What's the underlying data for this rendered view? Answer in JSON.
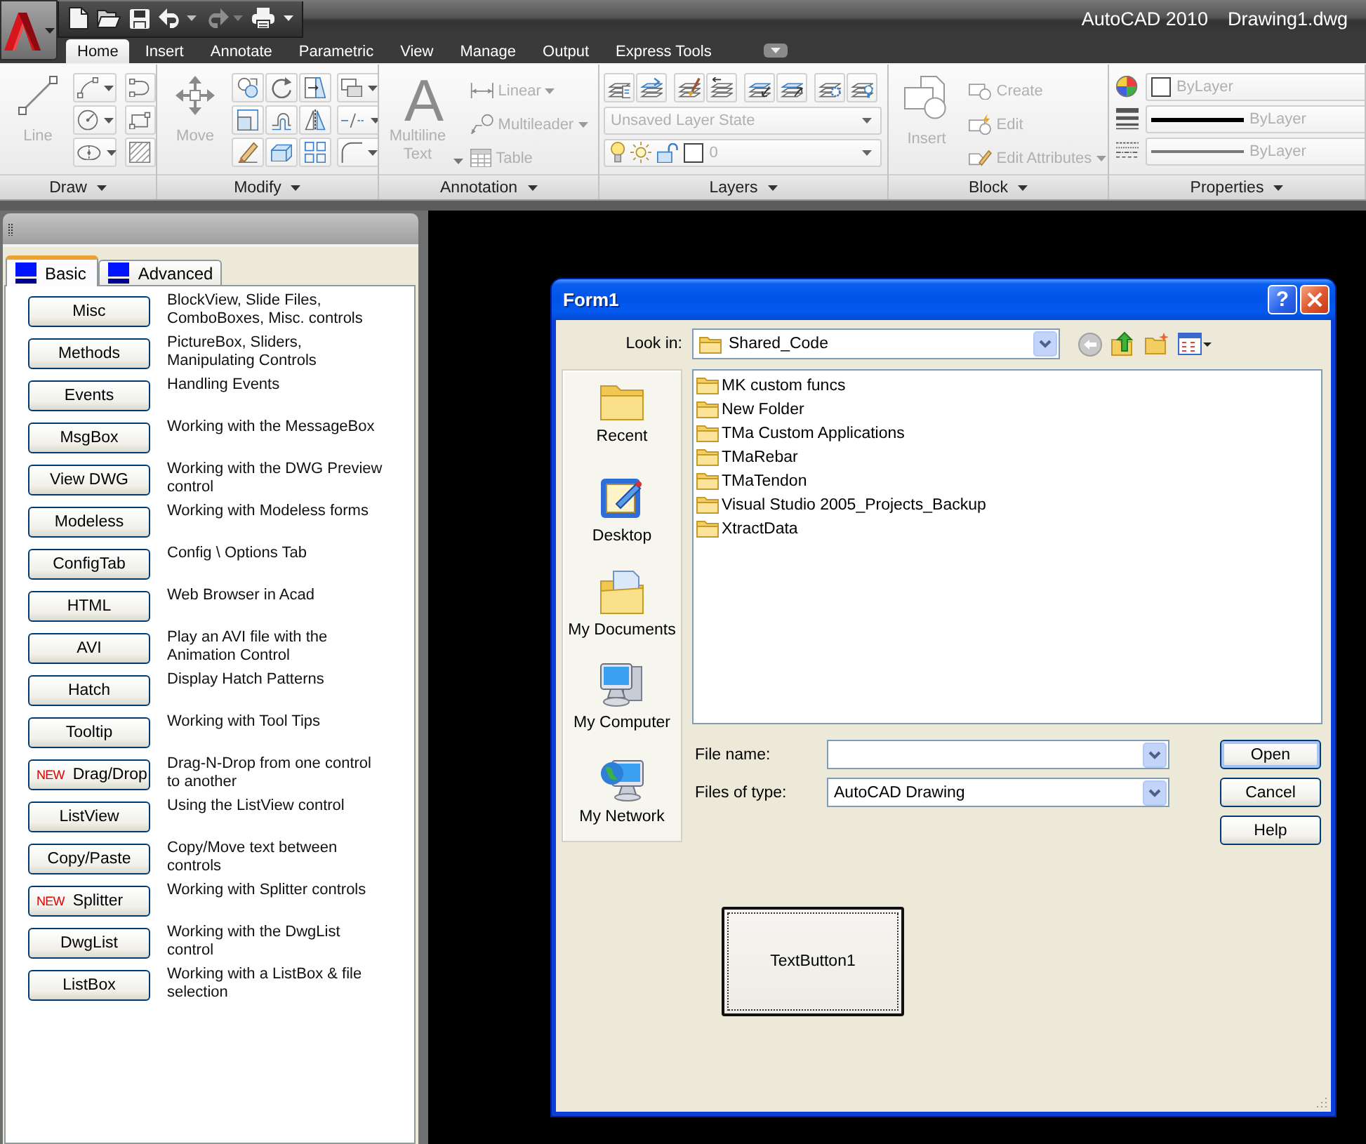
{
  "title_bar": {
    "app_title": "AutoCAD 2010",
    "document_title": "Drawing1.dwg"
  },
  "quick_access": [
    {
      "kind": "new",
      "disabled": false
    },
    {
      "kind": "open",
      "disabled": false
    },
    {
      "kind": "save",
      "disabled": false
    },
    {
      "kind": "undo",
      "disabled": false
    },
    {
      "kind": "redo",
      "disabled": true
    },
    {
      "kind": "plot",
      "disabled": false
    }
  ],
  "ribbon": {
    "tabs": [
      {
        "label": "Home",
        "selected": true
      },
      {
        "label": "Insert",
        "selected": false
      },
      {
        "label": "Annotate",
        "selected": false
      },
      {
        "label": "Parametric",
        "selected": false
      },
      {
        "label": "View",
        "selected": false
      },
      {
        "label": "Manage",
        "selected": false
      },
      {
        "label": "Output",
        "selected": false
      },
      {
        "label": "Express Tools",
        "selected": false
      }
    ],
    "panels": [
      {
        "kind": "draw",
        "title": "Draw",
        "tools": [
          {
            "label": "Line",
            "disabled": true
          }
        ]
      },
      {
        "kind": "modify",
        "title": "Modify",
        "tools": [
          {
            "label": "Move",
            "disabled": true
          }
        ]
      },
      {
        "kind": "annotation",
        "title": "Annotation",
        "tools": [
          {
            "label": "Multiline Text",
            "glyph": "A",
            "disabled": true
          },
          {
            "label": "Linear",
            "disabled": true
          },
          {
            "label": "Multileader",
            "disabled": true
          },
          {
            "label": "Table",
            "disabled": true
          }
        ]
      },
      {
        "kind": "layers",
        "title": "Layers",
        "layer_state": {
          "value": "Unsaved Layer State",
          "disabled": true
        },
        "layer": {
          "value": "0",
          "disabled": true
        }
      },
      {
        "kind": "block",
        "title": "Block",
        "tools": [
          {
            "label": "Insert",
            "disabled": true
          },
          {
            "label": "Create",
            "disabled": true
          },
          {
            "label": "Edit",
            "disabled": true
          },
          {
            "label": "Edit Attributes",
            "disabled": true
          }
        ]
      },
      {
        "kind": "properties",
        "title": "Properties",
        "rows": [
          {
            "kind": "color",
            "value": "ByLayer",
            "disabled": true
          },
          {
            "kind": "lineweight",
            "value": "ByLayer",
            "disabled": true
          },
          {
            "kind": "linetype",
            "value": "ByLayer",
            "disabled": true
          }
        ]
      }
    ]
  },
  "palette": {
    "tabs": [
      {
        "label": "Basic",
        "selected": true
      },
      {
        "label": "Advanced",
        "selected": false
      }
    ],
    "samples": [
      {
        "button": "Misc",
        "description": "BlockView, Slide Files, ComboBoxes, Misc. controls"
      },
      {
        "button": "Methods",
        "description": "PictureBox, Sliders, Manipulating Controls"
      },
      {
        "button": "Events",
        "description": "Handling Events"
      },
      {
        "button": "MsgBox",
        "description": "Working with the MessageBox"
      },
      {
        "button": "View DWG",
        "description": "Working with the DWG Preview control"
      },
      {
        "button": "Modeless",
        "description": "Working with Modeless forms"
      },
      {
        "button": "ConfigTab",
        "description": "Config \\ Options Tab"
      },
      {
        "button": "HTML",
        "description": "Web Browser in Acad"
      },
      {
        "button": "AVI",
        "description": "Play an AVI file with the Animation Control"
      },
      {
        "button": "Hatch",
        "description": "Display Hatch Patterns"
      },
      {
        "button": "Tooltip",
        "description": "Working with Tool Tips"
      },
      {
        "button": "Drag/Drop",
        "badge": "NEW",
        "description": "Drag-N-Drop from one control to another"
      },
      {
        "button": "ListView",
        "description": "Using the ListView control"
      },
      {
        "button": "Copy/Paste",
        "description": "Copy/Move text between controls"
      },
      {
        "button": "Splitter",
        "badge": "NEW",
        "description": "Working with Splitter controls"
      },
      {
        "button": "DwgList",
        "description": "Working with the DwgList control"
      },
      {
        "button": "ListBox",
        "description": "Working with a ListBox & file selection"
      }
    ]
  },
  "dialog": {
    "title": "Form1",
    "title_buttons": [
      {
        "kind": "help",
        "glyph": "?"
      },
      {
        "kind": "close"
      }
    ],
    "look_in": {
      "label": "Look in:",
      "value": "Shared_Code"
    },
    "places": [
      {
        "kind": "recent",
        "label": "Recent"
      },
      {
        "kind": "desktop",
        "label": "Desktop"
      },
      {
        "kind": "documents",
        "label": "My Documents"
      },
      {
        "kind": "computer",
        "label": "My Computer"
      },
      {
        "kind": "network",
        "label": "My Network"
      }
    ],
    "files": [
      {
        "name": "MK custom funcs",
        "selected": false
      },
      {
        "name": "New Folder",
        "selected": false
      },
      {
        "name": "TMa Custom Applications",
        "selected": false
      },
      {
        "name": "TMaRebar",
        "selected": false
      },
      {
        "name": "TMaTendon",
        "selected": false
      },
      {
        "name": "Visual Studio 2005_Projects_Backup",
        "selected": false
      },
      {
        "name": "XtractData",
        "selected": false
      }
    ],
    "file_name": {
      "label": "File name:"
    },
    "file_type": {
      "label": "Files of type:",
      "value": "AutoCAD Drawing"
    },
    "buttons": [
      {
        "label": "Open",
        "default": true
      },
      {
        "label": "Cancel",
        "default": false
      },
      {
        "label": "Help",
        "default": false
      }
    ],
    "text_button": {
      "label": "TextButton1",
      "focused": true
    }
  }
}
